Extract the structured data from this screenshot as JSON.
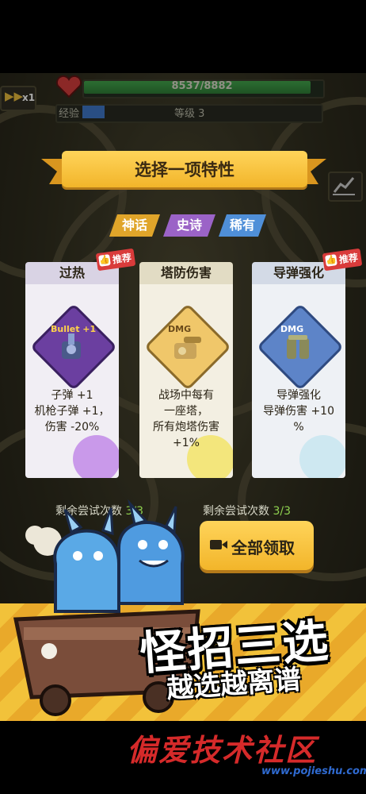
{
  "hud": {
    "hp_text": "8537/8882",
    "hp_fraction": 0.961,
    "speed_label": "x1",
    "exp_label": "经验",
    "level_text": "等级 3"
  },
  "dialog": {
    "title": "选择一项特性",
    "rarity_tags": [
      "神话",
      "史诗",
      "稀有"
    ]
  },
  "cards": [
    {
      "title": "过热",
      "icon": "gun-turret-icon",
      "icon_badge": "Bullet +1",
      "recommended": true,
      "recommend_label": "推荐",
      "desc": [
        "子弹 +1",
        "机枪子弹 +1，",
        "伤害 -20%"
      ],
      "accent": "#6b3fa0"
    },
    {
      "title": "塔防伤害",
      "icon": "cannon-tower-icon",
      "icon_badge": "DMG",
      "recommended": false,
      "desc": [
        "战场中每有",
        "一座塔，",
        "所有炮塔伤害",
        "+1%"
      ],
      "accent": "#f0c76a"
    },
    {
      "title": "导弹强化",
      "icon": "missile-launcher-icon",
      "icon_badge": "DMG",
      "recommended": true,
      "recommend_label": "推荐",
      "desc": [
        "导弹强化",
        "导弹伤害 +10",
        "%"
      ],
      "accent": "#5d84c8"
    }
  ],
  "retries": {
    "left_label": "剩余尝试次数",
    "left_count": "3/3",
    "right_label": "剩余尝试次数",
    "right_count": "3/3"
  },
  "claim_button": {
    "label": "全部领取"
  },
  "promo": {
    "title": "怪招三选",
    "subtitle": "越选越离谱"
  },
  "watermark": {
    "text": "偏爱技术社区",
    "url": "www.pojieshu.com"
  }
}
